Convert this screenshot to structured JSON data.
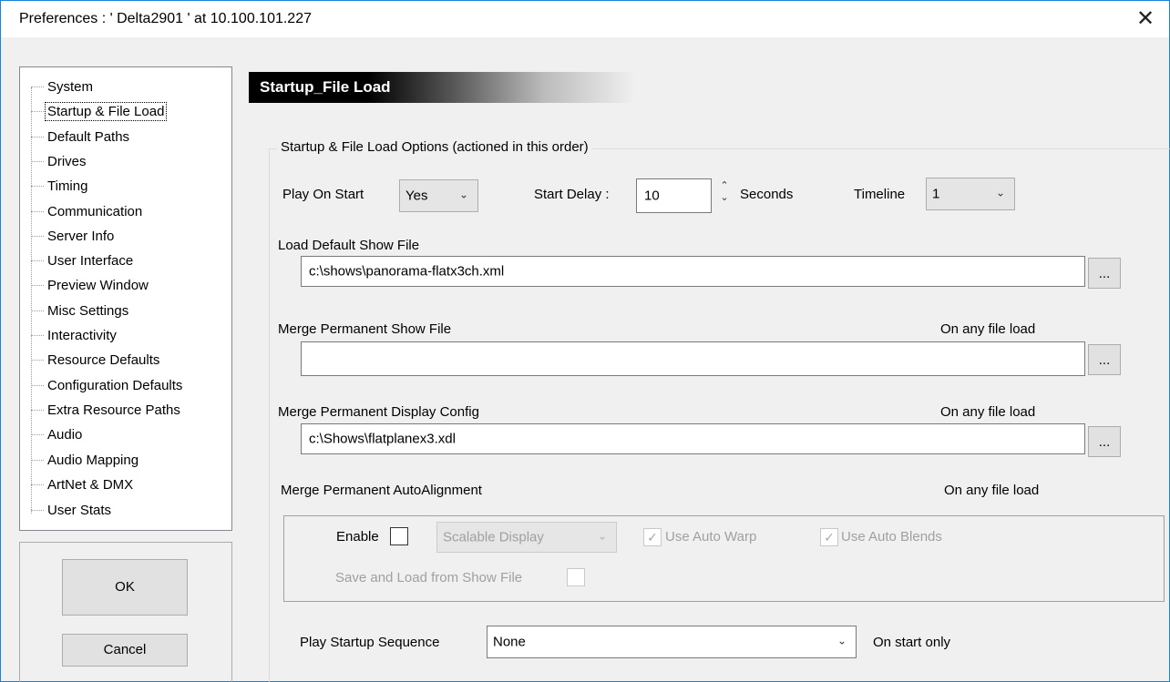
{
  "window": {
    "title": "Preferences  :  ' Delta2901 '  at  10.100.101.227",
    "close_glyph": "✕"
  },
  "sidebar": {
    "items": [
      {
        "label": "System"
      },
      {
        "label": "Startup & File Load"
      },
      {
        "label": "Default Paths"
      },
      {
        "label": "Drives"
      },
      {
        "label": "Timing"
      },
      {
        "label": "Communication"
      },
      {
        "label": "Server Info"
      },
      {
        "label": "User Interface"
      },
      {
        "label": "Preview Window"
      },
      {
        "label": "Misc Settings"
      },
      {
        "label": "Interactivity"
      },
      {
        "label": "Resource Defaults"
      },
      {
        "label": "Configuration Defaults"
      },
      {
        "label": "Extra Resource Paths"
      },
      {
        "label": "Audio"
      },
      {
        "label": "Audio Mapping"
      },
      {
        "label": "ArtNet & DMX"
      },
      {
        "label": "User Stats"
      }
    ],
    "selected": "Startup & File Load"
  },
  "buttons": {
    "ok": "OK",
    "cancel": "Cancel"
  },
  "panel": {
    "header": "Startup_File Load",
    "group_title": "Startup & File Load Options (actioned in this order)",
    "play_on_start": {
      "label": "Play On Start",
      "value": "Yes"
    },
    "start_delay": {
      "label": "Start Delay :",
      "value": "10",
      "units": "Seconds"
    },
    "timeline": {
      "label": "Timeline",
      "value": "1"
    },
    "default_show": {
      "label": "Load Default Show File",
      "value": "c:\\shows\\panorama-flatx3ch.xml",
      "browse": "..."
    },
    "perm_show": {
      "label": "Merge Permanent Show File",
      "note": "On any file load",
      "value": "",
      "browse": "..."
    },
    "perm_display": {
      "label": "Merge Permanent Display Config",
      "note": "On any file load",
      "value": "c:\\Shows\\flatplanex3.xdl",
      "browse": "..."
    },
    "auto_alignment": {
      "label": "Merge Permanent AutoAlignment",
      "note": "On any file load",
      "enable_label": "Enable",
      "enable_checked": false,
      "mode_value": "Scalable Display",
      "use_auto_warp": "Use Auto Warp",
      "use_auto_blends": "Use Auto Blends",
      "save_load": "Save and Load from Show File"
    },
    "startup_sequence": {
      "label": "Play Startup Sequence",
      "value": "None",
      "note": "On start only"
    }
  }
}
